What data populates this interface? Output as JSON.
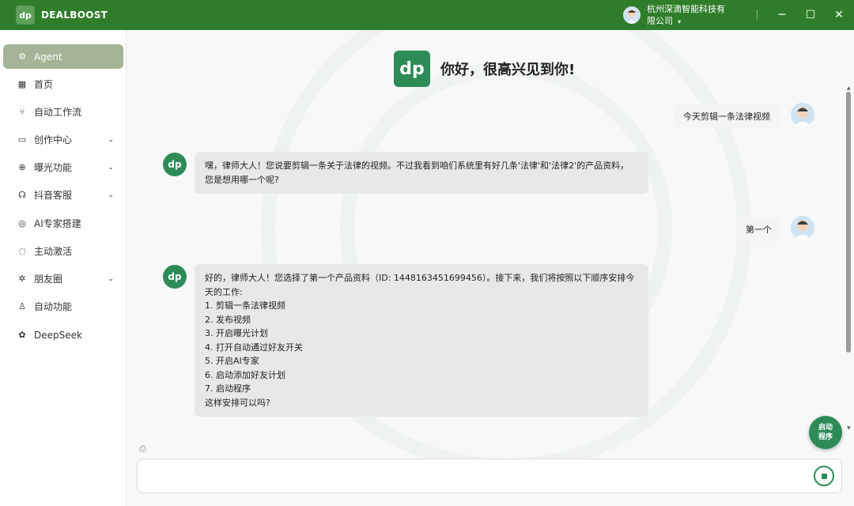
{
  "app": {
    "brand_logo": "dp",
    "brand_name": "DEALBOOST",
    "company_line1": "杭州深滴智能科技有",
    "company_line2": "限公司",
    "company_caret": "▾",
    "win_minimize": "─",
    "win_maximize": "☐",
    "win_close": "✕",
    "accent_color": "#2f7d2a"
  },
  "sidebar": {
    "items": [
      {
        "label": "Agent",
        "icon": "robot-icon",
        "glyph": "⚙",
        "active": true
      },
      {
        "label": "首页",
        "icon": "grid-icon",
        "glyph": "▦"
      },
      {
        "label": "自动工作流",
        "icon": "branch-icon",
        "glyph": "⑂"
      },
      {
        "label": "创作中心",
        "icon": "video-icon",
        "glyph": "▭",
        "chevron": "⌄"
      },
      {
        "label": "曝光功能",
        "icon": "zoom-icon",
        "glyph": "⊕",
        "chevron": "⌄"
      },
      {
        "label": "抖音客服",
        "icon": "headset-icon",
        "glyph": "☊",
        "chevron": "⌄"
      },
      {
        "label": "AI专家搭建",
        "icon": "expert-icon",
        "glyph": "◎"
      },
      {
        "label": "主动激活",
        "icon": "chat-icon",
        "glyph": "◌"
      },
      {
        "label": "朋友圈",
        "icon": "moments-icon",
        "glyph": "✲",
        "chevron": "⌄"
      },
      {
        "label": "自动功能",
        "icon": "people-icon",
        "glyph": "♙"
      },
      {
        "label": "DeepSeek",
        "icon": "deepseek-icon",
        "glyph": "✿"
      }
    ]
  },
  "main": {
    "hero_logo": "dp",
    "hero_title": "你好，很高兴见到你!",
    "messages": [
      {
        "role": "user",
        "text": "今天剪辑一条法律视频"
      },
      {
        "role": "bot",
        "lines": [
          "嘿，律师大人！您说要剪辑一条关于法律的视频。不过我看到咱们系统里有好几条'法律'和'法律2'的产品资料，",
          "您是想用哪一个呢?"
        ]
      },
      {
        "role": "user",
        "text": "第一个"
      },
      {
        "role": "bot",
        "lines": [
          "好的，律师大人！您选择了第一个产品资料（ID: 1448163451699456）。接下来，我们将按照以下顺序安排今",
          "天的工作:",
          "1. 剪辑一条法律视频",
          "2. 发布视频",
          "3. 开启曝光计划",
          "4. 打开自动通过好友开关",
          "5. 开启AI专家",
          "6. 启动添加好友计划",
          "7. 启动程序",
          "这样安排可以吗?"
        ]
      }
    ],
    "bot_avatar": "dp",
    "fab_line1": "启动",
    "fab_line2": "程序",
    "input_placeholder": "",
    "attach_icon": "⎙"
  }
}
